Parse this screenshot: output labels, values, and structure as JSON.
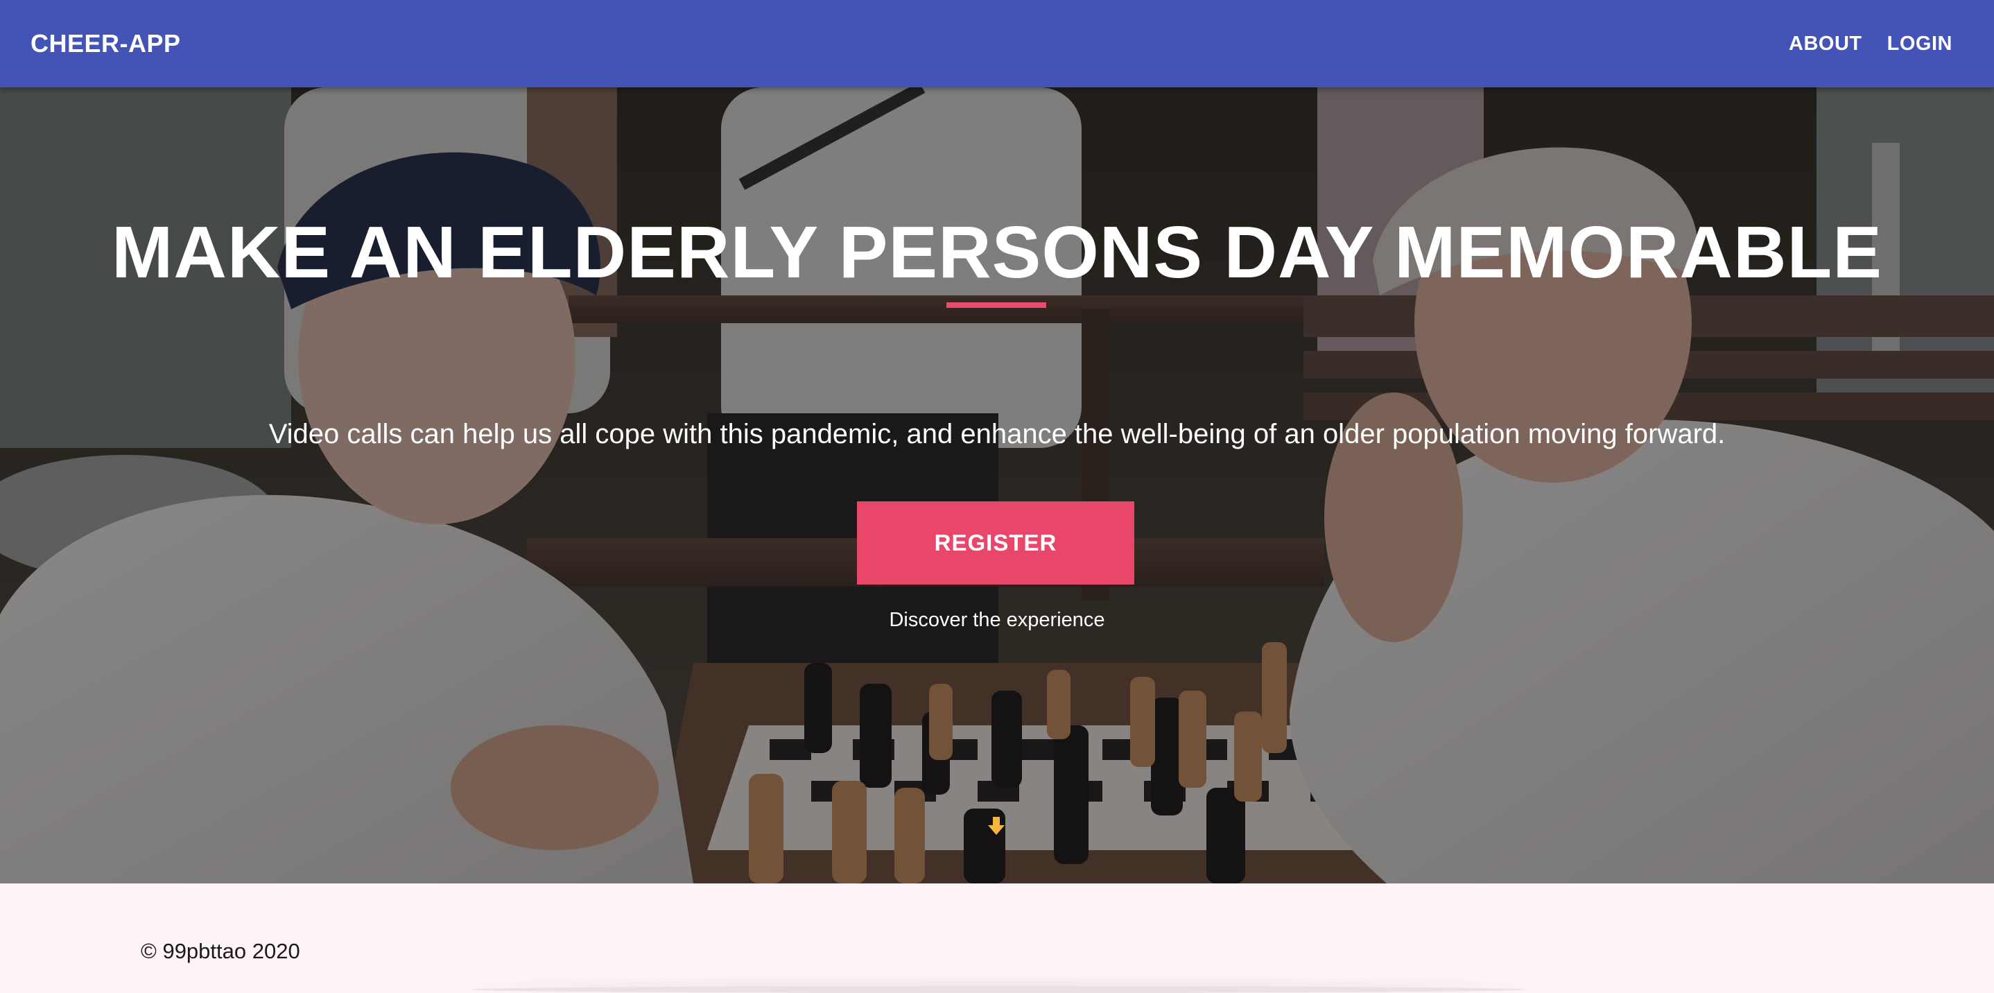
{
  "navbar": {
    "brand": "CHEER-APP",
    "links": [
      {
        "label": "ABOUT"
      },
      {
        "label": "LOGIN"
      }
    ],
    "background_color": "#4353b6"
  },
  "hero": {
    "title": "MAKE AN ELDERLY PERSONS DAY MEMORABLE",
    "subtitle": "Video calls can help us all cope with this pandemic, and enhance the well-being of an older population moving forward.",
    "register_label": "REGISTER",
    "caption": "Discover the experience",
    "accent_color": "#e9476a",
    "scroll_icon": "arrow-down-icon",
    "background_image": "two-elderly-men-playing-chess-photo"
  },
  "footer": {
    "copyright": "© 99pbttao 2020",
    "background_color": "#fff5f8"
  }
}
